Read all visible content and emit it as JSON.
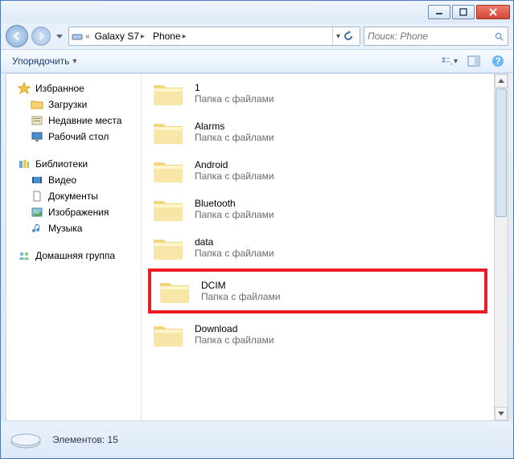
{
  "breadcrumb": {
    "seg1": "Galaxy S7",
    "seg2": "Phone"
  },
  "search": {
    "placeholder": "Поиск: Phone"
  },
  "toolbar": {
    "organize": "Упорядочить"
  },
  "sidebar": {
    "favorites": {
      "label": "Избранное",
      "items": [
        "Загрузки",
        "Недавние места",
        "Рабочий стол"
      ]
    },
    "libraries": {
      "label": "Библиотеки",
      "items": [
        "Видео",
        "Документы",
        "Изображения",
        "Музыка"
      ]
    },
    "homegroup": {
      "label": "Домашняя группа"
    }
  },
  "folders": {
    "subtype": "Папка с файлами",
    "items": [
      "1",
      "Alarms",
      "Android",
      "Bluetooth",
      "data",
      "DCIM",
      "Download"
    ],
    "highlighted": "DCIM"
  },
  "status": {
    "label": "Элементов: 15"
  }
}
